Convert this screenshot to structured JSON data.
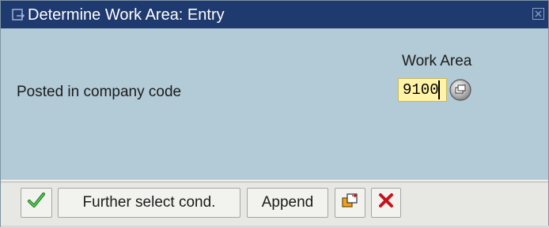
{
  "window": {
    "title": "Determine Work Area: Entry",
    "icons": {
      "title": "dialog-icon",
      "close": "close-icon"
    }
  },
  "form": {
    "column_header": "Work Area",
    "field_label": "Posted in company code",
    "field_value": "9100",
    "help_icon": "possible-entries-icon"
  },
  "toolbar": {
    "buttons": [
      {
        "name": "continue",
        "icon": "green-check-icon"
      },
      {
        "name": "further",
        "label": "Further select cond."
      },
      {
        "name": "append",
        "label": "Append"
      },
      {
        "name": "multiple",
        "icon": "multiple-selection-icon"
      },
      {
        "name": "cancel",
        "icon": "red-x-icon"
      }
    ]
  },
  "colors": {
    "title_bar": "#1f3a6e",
    "content_bg": "#b3cbd7",
    "input_bg": "#fff3a8",
    "toolbar_bg": "#e7e7e4"
  }
}
